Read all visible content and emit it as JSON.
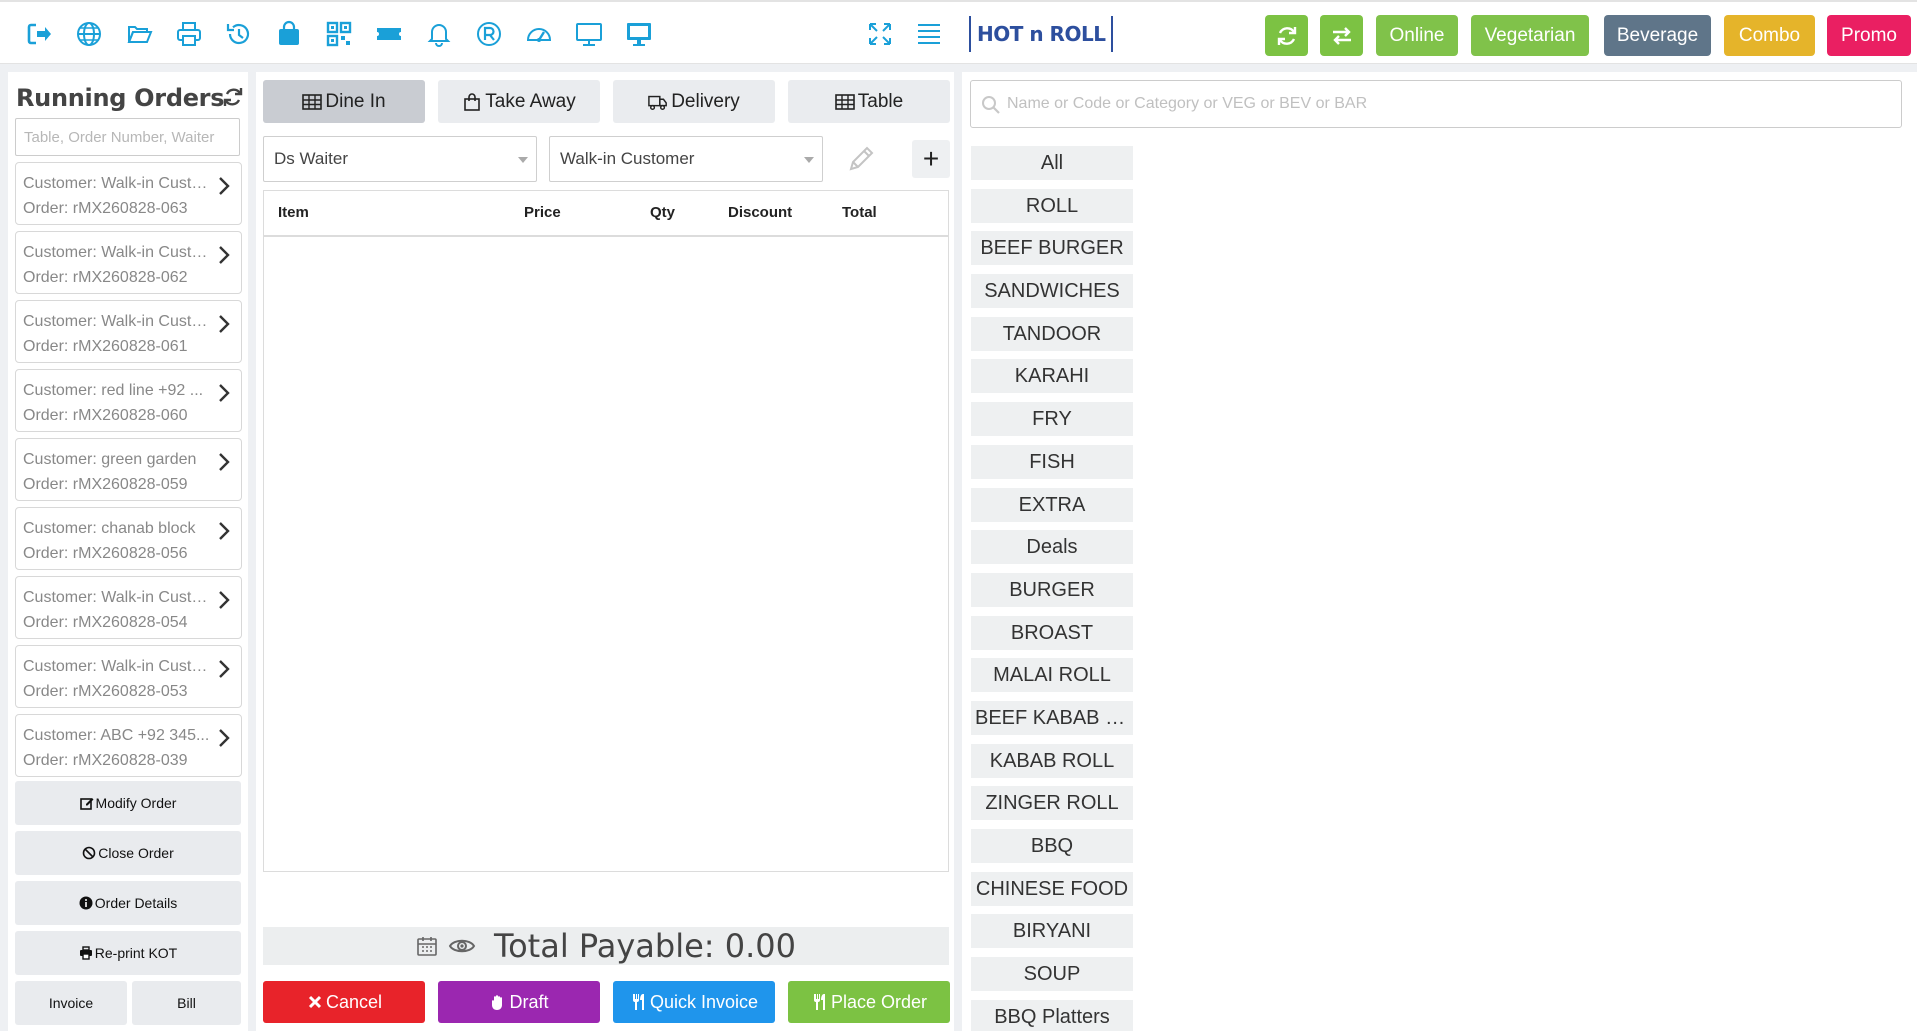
{
  "topbar": {
    "icons": [
      "logout-icon",
      "globe-icon",
      "folder-open-icon",
      "print-icon",
      "history-icon",
      "shopping-bag-icon",
      "qrcode-icon",
      "ticket-icon",
      "bell-icon",
      "registered-icon",
      "dashboard-icon",
      "monitor-icon",
      "desktop-icon"
    ],
    "brand": "HOT n ROLL",
    "buttons": {
      "refresh_color": "#7cc243",
      "swap_color": "#7cc243",
      "online": "Online",
      "online_color": "#80c24a",
      "vegetarian": "Vegetarian",
      "vegetarian_color": "#80c24a",
      "beverage": "Beverage",
      "beverage_color": "#5f7589",
      "combo": "Combo",
      "combo_color": "#e5b42a",
      "promo": "Promo",
      "promo_color": "#ea1f62"
    }
  },
  "running_orders": {
    "title": "Running Orders",
    "search_placeholder": "Table, Order Number, Waiter",
    "orders": [
      {
        "customer": "Customer: Walk-in Customer",
        "order": "Order: rMX260828-063"
      },
      {
        "customer": "Customer: Walk-in Customer",
        "order": "Order: rMX260828-062"
      },
      {
        "customer": "Customer: Walk-in Customer",
        "order": "Order: rMX260828-061"
      },
      {
        "customer": "Customer: red line +92 ...",
        "order": "Order: rMX260828-060"
      },
      {
        "customer": "Customer: green garden",
        "order": "Order: rMX260828-059"
      },
      {
        "customer": "Customer: chanab block",
        "order": "Order: rMX260828-056"
      },
      {
        "customer": "Customer: Walk-in Customer",
        "order": "Order: rMX260828-054"
      },
      {
        "customer": "Customer: Walk-in Customer",
        "order": "Order: rMX260828-053"
      },
      {
        "customer": "Customer: ABC +92 345...",
        "order": "Order: rMX260828-039"
      }
    ],
    "actions": {
      "modify": "Modify Order",
      "close": "Close Order",
      "details": "Order Details",
      "reprint": "Re-print KOT",
      "invoice": "Invoice",
      "bill": "Bill"
    }
  },
  "order_panel": {
    "tabs": {
      "dine_in": "Dine In",
      "take_away": "Take Away",
      "delivery": "Delivery",
      "table": "Table"
    },
    "waiter": "Ds Waiter",
    "customer": "Walk-in Customer",
    "add_symbol": "+",
    "columns": {
      "item": "Item",
      "price": "Price",
      "qty": "Qty",
      "discount": "Discount",
      "total": "Total"
    },
    "total_payable": "Total Payable: 0.00",
    "buttons": {
      "cancel": "Cancel",
      "cancel_color": "#e8232a",
      "draft": "Draft",
      "draft_color": "#9b27b0",
      "quick_invoice": "Quick Invoice",
      "quick_invoice_color": "#1f95ec",
      "place_order": "Place Order",
      "place_order_color": "#7cc243"
    }
  },
  "menu": {
    "search_placeholder": "Name or Code or Category or VEG or BEV or BAR",
    "categories": [
      "All",
      "ROLL",
      "BEEF BURGER",
      "SANDWICHES",
      "TANDOOR",
      "KARAHI",
      "FRY",
      "FISH",
      "EXTRA",
      "Deals",
      "BURGER",
      "BROAST",
      "MALAI ROLL",
      "BEEF KABAB ROLL",
      "KABAB ROLL",
      "ZINGER ROLL",
      "BBQ",
      "CHINESE FOOD",
      "BIRYANI",
      "SOUP",
      "BBQ Platters"
    ]
  }
}
